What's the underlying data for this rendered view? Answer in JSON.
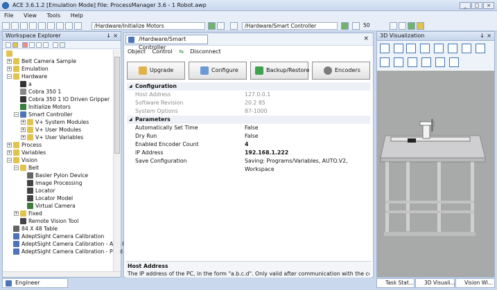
{
  "window": {
    "title": "ACE 3.6.1.2 [Emulation Mode]  File: ProcessManager 3.6 - 1 Robot.awp"
  },
  "menu": [
    "File",
    "View",
    "Tools",
    "Help"
  ],
  "toolbar": {
    "path_combo": "/Hardware/Initialize Motors",
    "controller_combo": "/Hardware/Smart Controller",
    "speed": "50"
  },
  "explorer": {
    "title": "Workspace Explorer",
    "pin": "↓",
    "close": "×",
    "tree": [
      {
        "label": "Belt Camera Sample",
        "depth": 1,
        "exp": "+",
        "color": "#e2c34d"
      },
      {
        "label": "Emulation",
        "depth": 1,
        "exp": "+",
        "color": "#e2c34d"
      },
      {
        "label": "Hardware",
        "depth": 1,
        "exp": "−",
        "color": "#e2c34d"
      },
      {
        "label": "a",
        "depth": 2,
        "exp": "",
        "color": "#333"
      },
      {
        "label": "Cobra 350 1",
        "depth": 2,
        "exp": "",
        "color": "#888"
      },
      {
        "label": "Cobra 350 1 IO Driven Gripper",
        "depth": 2,
        "exp": "",
        "color": "#333"
      },
      {
        "label": "Initialize Motors",
        "depth": 2,
        "exp": "",
        "color": "#3a7f3a"
      },
      {
        "label": "Smart Controller",
        "depth": 2,
        "exp": "−",
        "color": "#4d74b6"
      },
      {
        "label": "V+ System Modules",
        "depth": 3,
        "exp": "+",
        "color": "#e2c34d"
      },
      {
        "label": "V+ User Modules",
        "depth": 3,
        "exp": "+",
        "color": "#e2c34d"
      },
      {
        "label": "V+ User Variables",
        "depth": 3,
        "exp": "+",
        "color": "#e2c34d"
      },
      {
        "label": "Process",
        "depth": 1,
        "exp": "+",
        "color": "#e2c34d"
      },
      {
        "label": "Variables",
        "depth": 1,
        "exp": "+",
        "color": "#e2c34d"
      },
      {
        "label": "Vision",
        "depth": 1,
        "exp": "−",
        "color": "#e2c34d"
      },
      {
        "label": "Belt",
        "depth": 2,
        "exp": "−",
        "color": "#e2c34d"
      },
      {
        "label": "Basler Pylon Device",
        "depth": 3,
        "exp": "",
        "color": "#666"
      },
      {
        "label": "Image Processing",
        "depth": 3,
        "exp": "",
        "color": "#444"
      },
      {
        "label": "Locator",
        "depth": 3,
        "exp": "",
        "color": "#444"
      },
      {
        "label": "Locator Model",
        "depth": 3,
        "exp": "",
        "color": "#444"
      },
      {
        "label": "Virtual Camera",
        "depth": 3,
        "exp": "",
        "color": "#3a7f3a"
      },
      {
        "label": "Fixed",
        "depth": 2,
        "exp": "+",
        "color": "#e2c34d"
      },
      {
        "label": "Remote Vision Tool",
        "depth": 2,
        "exp": "",
        "color": "#444"
      },
      {
        "label": "84 X 48 Table",
        "depth": 1,
        "exp": "",
        "color": "#666"
      },
      {
        "label": "AdeptSight Camera Calibration",
        "depth": 1,
        "exp": "",
        "color": "#4d74b6"
      },
      {
        "label": "AdeptSight Camera Calibration - Arm I",
        "depth": 1,
        "exp": "",
        "color": "#4d74b6"
      },
      {
        "label": "AdeptSight Camera Calibration - Point-",
        "depth": 1,
        "exp": "",
        "color": "#4d74b6"
      }
    ]
  },
  "engineer_tab": "Engineer",
  "editor": {
    "tab_title": "/Hardware/Smart Controller",
    "close": "×",
    "menu": [
      "Object",
      "Control",
      "Disconnect"
    ],
    "buttons": [
      {
        "label": "Upgrade",
        "icon": "upgrade-icon",
        "color": "#e2b14a"
      },
      {
        "label": "Configure",
        "icon": "configure-icon",
        "color": "#6a9ad6"
      },
      {
        "label": "Backup/Restore",
        "icon": "backup-restore-icon",
        "color": "#3fa24d"
      },
      {
        "label": "Encoders",
        "icon": "encoders-icon",
        "color": "#7c7c7c"
      }
    ],
    "sections": [
      {
        "name": "Configuration",
        "rows": [
          {
            "key": "Host Address",
            "value": "127.0.0.1",
            "muted": true
          },
          {
            "key": "Software Revision",
            "value": "20.2 85",
            "muted": true
          },
          {
            "key": "System Options",
            "value": "87-1000",
            "muted": true
          }
        ]
      },
      {
        "name": "Parameters",
        "rows": [
          {
            "key": "Automatically Set Time",
            "value": "False",
            "muted": false
          },
          {
            "key": "Dry Run",
            "value": "False",
            "muted": false
          },
          {
            "key": "Enabled Encoder Count",
            "value": "4",
            "muted": false,
            "bold": true
          },
          {
            "key": "IP Address",
            "value": "192.168.1.222",
            "muted": false,
            "bold": true
          },
          {
            "key": "Save Configuration",
            "value": "Saving: Programs/Variables, AUTO.V2, Workspace",
            "muted": false
          }
        ]
      }
    ],
    "description": {
      "heading": "Host Address",
      "text": "The IP address of the PC, in the form \"a.b.c.d\". Only valid after communication with the controller is e..."
    }
  },
  "viz": {
    "title": "3D Visualization",
    "pin": "↓",
    "close": "×",
    "tabs": [
      "Task Stat...",
      "3D Visuali...",
      "Vision Wi..."
    ]
  }
}
